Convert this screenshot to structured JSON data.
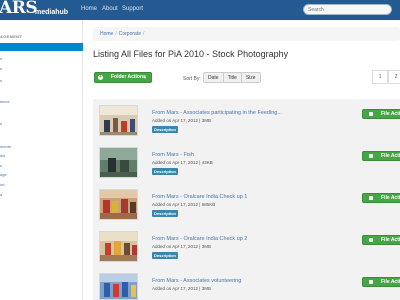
{
  "app": {
    "logo_main": "ARS",
    "logo_sub": "mediahub"
  },
  "topnav": {
    "items": [
      "Home",
      "About",
      "Support"
    ],
    "search_placeholder": "Search"
  },
  "sidebar": {
    "section_label": "AGEMENT",
    "items": [
      "",
      "s",
      "e",
      "s",
      "ience",
      "s",
      "ments",
      "ols",
      "s",
      "age",
      "ort",
      "a"
    ]
  },
  "breadcrumb": {
    "items": [
      "Home",
      "Corporate"
    ],
    "separator": "/"
  },
  "page": {
    "title": "Listing All Files for PiA 2010 - Stock Photography"
  },
  "toolbar": {
    "folder_actions_label": "Folder Actions",
    "sort_by_label": "Sort By:",
    "sort_options": [
      "Date",
      "Title",
      "Size"
    ]
  },
  "pagination": {
    "pages": [
      "1",
      "2"
    ]
  },
  "files": [
    {
      "title": "From Mars - Associates participating in the Feeding...",
      "meta": "Added on Apr 17, 2012 | 3MB",
      "badge": "Description",
      "action": "File Actions"
    },
    {
      "title": "From Mars - Fish",
      "meta": "Added on Apr 17, 2012 | 43KB",
      "badge": "Description",
      "action": "File Actions"
    },
    {
      "title": "From Mars - Oralcare India Check up 1",
      "meta": "Added on Apr 17, 2012 | 585KB",
      "badge": "Description",
      "action": "File Actions"
    },
    {
      "title": "From Mars - Oralcare India Check up 2",
      "meta": "Added on Apr 17, 2012 | 3MB",
      "badge": "Description",
      "action": "File Actions"
    },
    {
      "title": "From Mars - Associates volunteering",
      "meta": "Added on Apr 17, 2012 | 3MB",
      "badge": "",
      "action": "File Actions"
    }
  ],
  "colors": {
    "nav_bg": "#235a92",
    "accent_blue": "#0088cc",
    "action_green": "#46a546",
    "badge_blue": "#3a87ad",
    "row_bg": "#f2f2f2"
  }
}
